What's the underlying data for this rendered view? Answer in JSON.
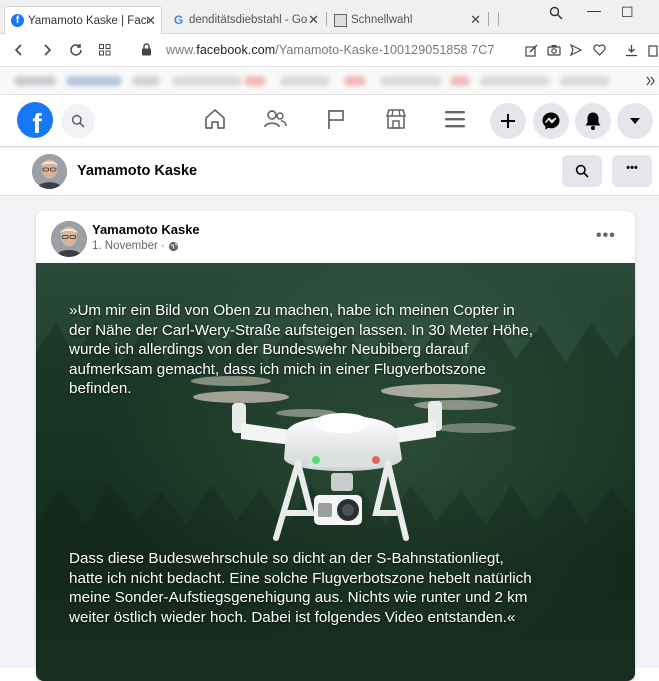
{
  "browser": {
    "tabs": [
      {
        "label": "Yamamoto Kaske | Faceb",
        "favicon": "facebook-favicon",
        "active": true
      },
      {
        "label": "denditätsdiebstahl - Go",
        "favicon": "google-favicon",
        "active": false
      },
      {
        "label": "Schnellwahl",
        "favicon": "speed-dial-favicon",
        "active": false
      }
    ],
    "url_prefix": "www.",
    "url_domain": "facebook.com",
    "url_path": "/Yamamoto-Kaske-100129051858 7C7"
  },
  "facebook": {
    "logo": "f",
    "brand_color": "#1877f2",
    "nav_icons": [
      "home-icon",
      "friends-icon",
      "pages-flag-icon",
      "marketplace-icon",
      "menu-icon"
    ],
    "action_icons": [
      "plus-icon",
      "messenger-icon",
      "notifications-bell-icon",
      "account-dropdown-icon"
    ]
  },
  "page": {
    "name": "Yamamoto Kaske",
    "more_label": "•••"
  },
  "post": {
    "author": "Yamamoto Kaske",
    "date": "1. November",
    "separator": "·",
    "more_label": "•••",
    "text_top": [
      "»Um mir ein Bild von Oben zu machen, habe ich meinen Copter in",
      "der Nähe der Carl-Wery-Straße aufsteigen lassen. In 30 Meter Höhe,",
      "wurde ich allerdings von der Bundeswehr Neubiberg darauf",
      "aufmerksam gemacht, dass ich mich in einer Flugverbotszone",
      "befinden."
    ],
    "text_bottom": [
      "Dass diese Budeswehrschule so dicht an der S-Bahnstationliegt,",
      "hatte ich nicht bedacht. Eine solche Flugverbotszone hebelt natürlich",
      "meine Sonder-Aufstiegsgenehigung aus. Nichts wie runter und 2 km",
      "weiter östlich wieder hoch. Dabei ist folgendes Video entstanden.«"
    ]
  }
}
